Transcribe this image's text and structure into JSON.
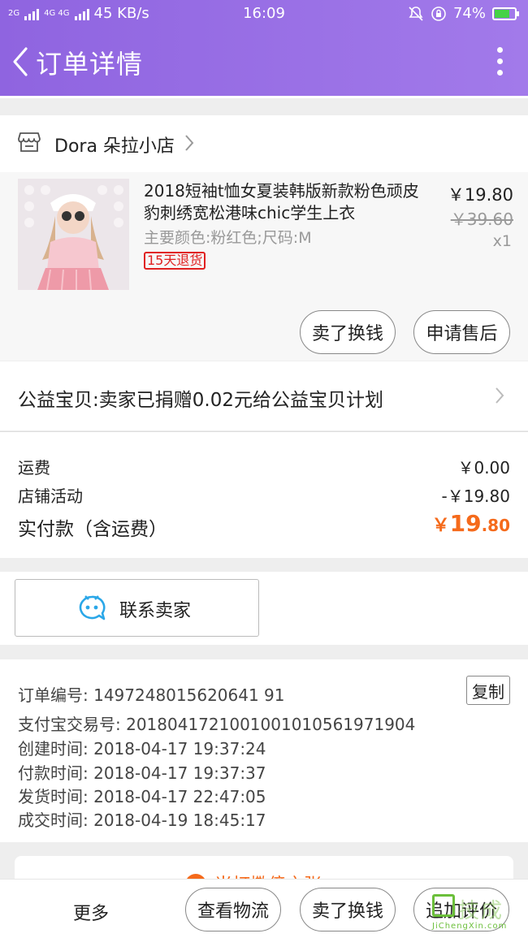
{
  "status_bar": {
    "signal_left": "2G",
    "signal_mid": "4G 4G",
    "net_speed": "45 KB/s",
    "time": "16:09",
    "battery_percent_text": "74%",
    "battery_level": 0.74
  },
  "header": {
    "title": "订单详情"
  },
  "shop": {
    "name": "Dora 朵拉小店"
  },
  "item": {
    "title": "2018短袖t恤女夏装韩版新款粉色顽皮豹刺绣宽松港味chic学生上衣",
    "spec": "主要颜色:粉红色;尺码:M",
    "badge": "15天退货",
    "price": "￥19.80",
    "original_price": "￥39.60",
    "quantity": "x1",
    "sell_button": "卖了换钱",
    "aftersale_button": "申请售后"
  },
  "charity": {
    "text": "公益宝贝:卖家已捐赠0.02元给公益宝贝计划"
  },
  "fees": {
    "shipping_label": "运费",
    "shipping_value": "￥0.00",
    "promo_label": "店铺活动",
    "promo_value": "-￥19.80",
    "paid_label": "实付款（含运费）",
    "paid_symbol": "￥",
    "paid_integer": "19",
    "paid_decimal": ".80"
  },
  "contact": {
    "label": "联系卖家"
  },
  "order_info": {
    "order_no": "订单编号: 1497248015620641 91",
    "copy_button": "复制",
    "alipay_no": "支付宝交易号: 2018041721001001010561971904",
    "created": "创建时间: 2018-04-17 19:37:24",
    "paid": "付款时间: 2018-04-17 19:37:37",
    "shipped": "发货时间: 2018-04-17 22:47:05",
    "completed": "成交时间: 2018-04-19 18:45:17"
  },
  "peek_banner": {
    "text": "当打撒傍之张"
  },
  "bottom_bar": {
    "more": "更多",
    "logistics_button": "查看物流",
    "sell_button": "卖了换钱",
    "review_button": "追加评价"
  },
  "watermark": {
    "cn": "技成",
    "en": "JiChengXin.com"
  },
  "colors": {
    "header": "#9b72e6",
    "accent_orange": "#f56a1b",
    "badge_red": "#e02020"
  }
}
